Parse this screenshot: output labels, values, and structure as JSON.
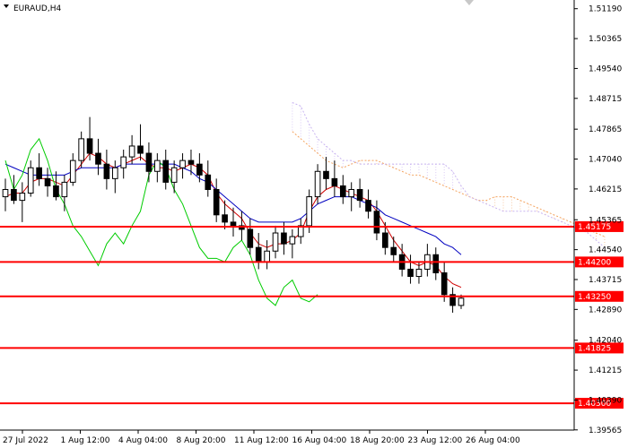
{
  "window": {
    "title": "EURAUD,H4"
  },
  "chart_data": {
    "type": "candlestick",
    "symbol": "EURAUD",
    "timeframe": "H4",
    "ylim": [
      1.3956,
      1.5143
    ],
    "price_ticks": [
      "1.51190",
      "1.50365",
      "1.49540",
      "1.48715",
      "1.47865",
      "1.47040",
      "1.46215",
      "1.45365",
      "1.44540",
      "1.43715",
      "1.42890",
      "1.42040",
      "1.41215",
      "1.40390",
      "1.39565"
    ],
    "time_labels": [
      "27 Jul 2022",
      "1 Aug 12:00",
      "4 Aug 04:00",
      "8 Aug 20:00",
      "11 Aug 12:00",
      "16 Aug 04:00",
      "18 Aug 20:00",
      "23 Aug 12:00",
      "26 Aug 04:00"
    ],
    "levels": [
      {
        "value": 1.45175,
        "label": "1.45175"
      },
      {
        "value": 1.442,
        "label": "1.44200"
      },
      {
        "value": 1.4325,
        "label": "1.43250"
      },
      {
        "value": 1.41825,
        "label": "1.41825"
      },
      {
        "value": 1.403,
        "label": "1.40300"
      }
    ],
    "candles": [
      [
        1.46,
        1.465,
        1.456,
        1.462
      ],
      [
        1.462,
        1.466,
        1.458,
        1.459
      ],
      [
        1.459,
        1.464,
        1.453,
        1.461
      ],
      [
        1.461,
        1.47,
        1.46,
        1.468
      ],
      [
        1.468,
        1.472,
        1.463,
        1.465
      ],
      [
        1.465,
        1.468,
        1.46,
        1.463
      ],
      [
        1.463,
        1.467,
        1.459,
        1.46
      ],
      [
        1.46,
        1.466,
        1.456,
        1.464
      ],
      [
        1.464,
        1.472,
        1.463,
        1.47
      ],
      [
        1.47,
        1.478,
        1.468,
        1.476
      ],
      [
        1.476,
        1.482,
        1.47,
        1.472
      ],
      [
        1.472,
        1.476,
        1.466,
        1.469
      ],
      [
        1.469,
        1.473,
        1.462,
        1.465
      ],
      [
        1.465,
        1.47,
        1.461,
        1.468
      ],
      [
        1.468,
        1.473,
        1.465,
        1.471
      ],
      [
        1.471,
        1.477,
        1.469,
        1.474
      ],
      [
        1.474,
        1.48,
        1.47,
        1.472
      ],
      [
        1.472,
        1.475,
        1.464,
        1.467
      ],
      [
        1.467,
        1.472,
        1.464,
        1.47
      ],
      [
        1.47,
        1.473,
        1.462,
        1.464
      ],
      [
        1.464,
        1.47,
        1.461,
        1.468
      ],
      [
        1.468,
        1.472,
        1.465,
        1.47
      ],
      [
        1.47,
        1.473,
        1.466,
        1.469
      ],
      [
        1.469,
        1.472,
        1.464,
        1.466
      ],
      [
        1.466,
        1.47,
        1.46,
        1.462
      ],
      [
        1.462,
        1.465,
        1.453,
        1.455
      ],
      [
        1.455,
        1.459,
        1.451,
        1.453
      ],
      [
        1.453,
        1.457,
        1.449,
        1.452
      ],
      [
        1.452,
        1.456,
        1.448,
        1.451
      ],
      [
        1.451,
        1.454,
        1.444,
        1.446
      ],
      [
        1.446,
        1.45,
        1.44,
        1.442
      ],
      [
        1.442,
        1.448,
        1.44,
        1.445
      ],
      [
        1.445,
        1.452,
        1.443,
        1.45
      ],
      [
        1.45,
        1.453,
        1.444,
        1.447
      ],
      [
        1.447,
        1.451,
        1.443,
        1.449
      ],
      [
        1.449,
        1.454,
        1.447,
        1.452
      ],
      [
        1.452,
        1.462,
        1.45,
        1.46
      ],
      [
        1.46,
        1.469,
        1.458,
        1.467
      ],
      [
        1.467,
        1.471,
        1.462,
        1.465
      ],
      [
        1.465,
        1.47,
        1.46,
        1.463
      ],
      [
        1.463,
        1.466,
        1.458,
        1.46
      ],
      [
        1.46,
        1.464,
        1.456,
        1.462
      ],
      [
        1.462,
        1.465,
        1.457,
        1.459
      ],
      [
        1.459,
        1.462,
        1.454,
        1.456
      ],
      [
        1.456,
        1.459,
        1.448,
        1.45
      ],
      [
        1.45,
        1.453,
        1.444,
        1.446
      ],
      [
        1.446,
        1.449,
        1.442,
        1.444
      ],
      [
        1.444,
        1.447,
        1.438,
        1.44
      ],
      [
        1.44,
        1.444,
        1.436,
        1.438
      ],
      [
        1.438,
        1.442,
        1.436,
        1.44
      ],
      [
        1.44,
        1.447,
        1.438,
        1.444
      ],
      [
        1.444,
        1.446,
        1.437,
        1.439
      ],
      [
        1.439,
        1.442,
        1.431,
        1.433
      ],
      [
        1.433,
        1.435,
        1.428,
        1.43
      ],
      [
        1.43,
        1.433,
        1.429,
        1.432
      ]
    ],
    "series": [
      {
        "role": "tenkan",
        "color": "#d00000",
        "values": [
          1.46,
          1.461,
          1.461,
          1.464,
          1.465,
          1.465,
          1.464,
          1.463,
          1.466,
          1.469,
          1.472,
          1.471,
          1.469,
          1.468,
          1.469,
          1.47,
          1.471,
          1.469,
          1.468,
          1.468,
          1.467,
          1.468,
          1.469,
          1.468,
          1.466,
          1.461,
          1.458,
          1.456,
          1.454,
          1.45,
          1.447,
          1.446,
          1.447,
          1.447,
          1.448,
          1.45,
          1.456,
          1.46,
          1.462,
          1.463,
          1.462,
          1.461,
          1.46,
          1.459,
          1.456,
          1.452,
          1.448,
          1.445,
          1.442,
          1.441,
          1.442,
          1.441,
          1.438,
          1.436,
          1.435
        ]
      },
      {
        "role": "kijun",
        "color": "#0000c0",
        "values": [
          1.469,
          1.468,
          1.467,
          1.466,
          1.466,
          1.466,
          1.466,
          1.466,
          1.467,
          1.468,
          1.468,
          1.468,
          1.468,
          1.468,
          1.469,
          1.469,
          1.469,
          1.469,
          1.469,
          1.469,
          1.469,
          1.468,
          1.467,
          1.465,
          1.464,
          1.462,
          1.46,
          1.458,
          1.456,
          1.454,
          1.453,
          1.453,
          1.453,
          1.453,
          1.453,
          1.454,
          1.456,
          1.458,
          1.459,
          1.46,
          1.46,
          1.46,
          1.459,
          1.458,
          1.457,
          1.455,
          1.454,
          1.453,
          1.452,
          1.451,
          1.45,
          1.449,
          1.447,
          1.446,
          1.444
        ]
      },
      {
        "role": "chikou",
        "color": "#00cc00",
        "values": [
          1.47,
          1.462,
          1.466,
          1.473,
          1.476,
          1.47,
          1.462,
          1.458,
          1.452,
          1.449,
          1.445,
          1.441,
          1.447,
          1.45,
          1.447,
          1.452,
          1.456,
          1.466,
          1.47,
          1.468,
          1.462,
          1.458,
          1.452,
          1.446,
          1.443,
          1.443,
          1.442,
          1.446,
          1.448,
          1.444,
          1.437,
          1.432,
          1.43,
          1.435,
          1.437,
          1.432,
          1.431,
          1.433
        ]
      },
      {
        "role": "senkou-a",
        "color": "#f4a460",
        "values": [
          1.478,
          1.476,
          1.474,
          1.472,
          1.47,
          1.469,
          1.468,
          1.469,
          1.47,
          1.47,
          1.47,
          1.469,
          1.468,
          1.467,
          1.466,
          1.466,
          1.465,
          1.464,
          1.463,
          1.462,
          1.461,
          1.46,
          1.459,
          1.459,
          1.46,
          1.46,
          1.46,
          1.459,
          1.458,
          1.457,
          1.456,
          1.455,
          1.454,
          1.453,
          1.452,
          1.451,
          1.45,
          1.449
        ]
      },
      {
        "role": "senkou-b",
        "color": "#c8b4f0",
        "values": [
          1.486,
          1.485,
          1.48,
          1.476,
          1.474,
          1.472,
          1.47,
          1.47,
          1.469,
          1.469,
          1.469,
          1.469,
          1.469,
          1.469,
          1.469,
          1.469,
          1.469,
          1.469,
          1.469,
          1.467,
          1.463,
          1.46,
          1.459,
          1.458,
          1.457,
          1.456,
          1.456,
          1.456,
          1.456,
          1.456,
          1.455,
          1.454,
          1.453,
          1.452,
          1.451,
          1.45,
          1.448,
          1.446
        ]
      }
    ],
    "grid": false,
    "colors": {
      "level": "#ff0000",
      "axis": "#000000",
      "candle": "#000000",
      "background": "#ffffff"
    }
  }
}
